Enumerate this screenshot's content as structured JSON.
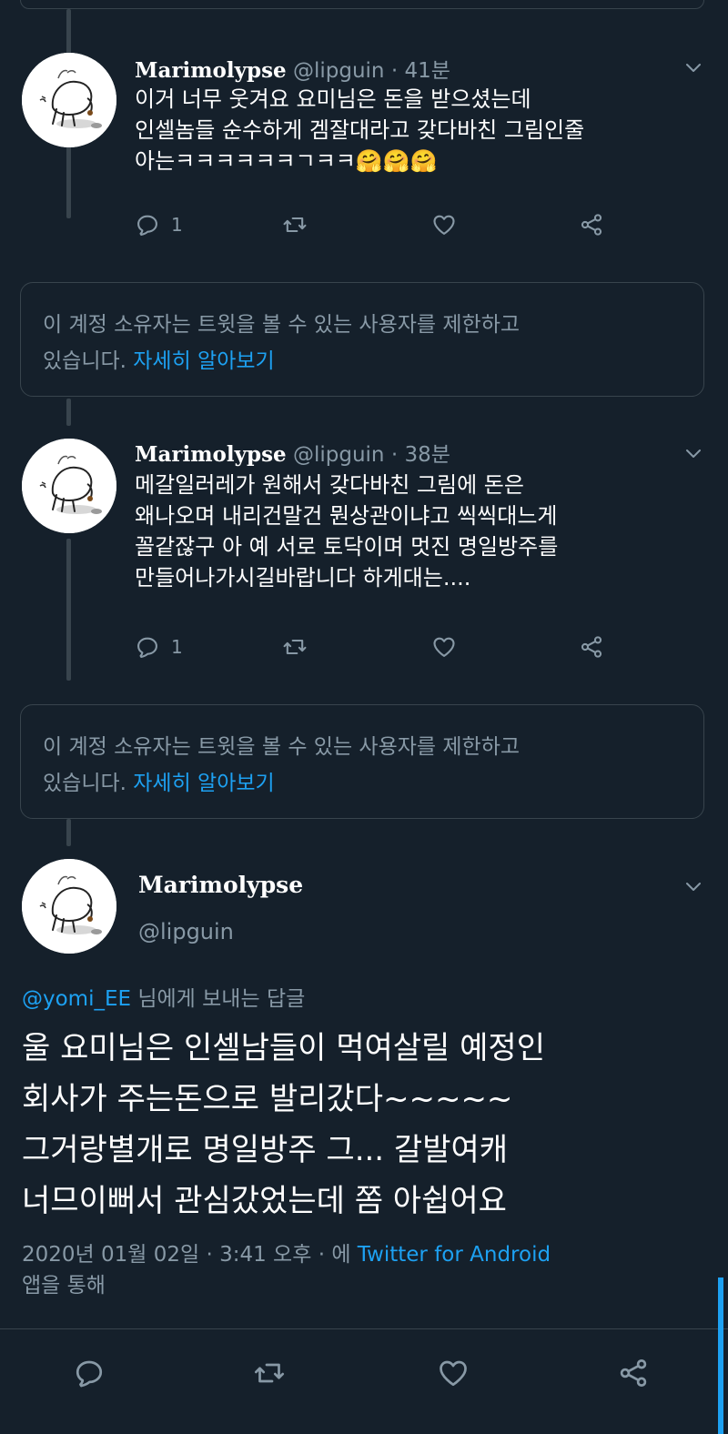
{
  "tweets": [
    {
      "name": "Marimolypse",
      "handle": "@lipguin",
      "time": "41분",
      "lines": [
        "이거 너무 웃겨요 요미님은 돈을 받으셨는데",
        "인셀놈들 순수하게 겜잘대라고 갖다바친 그림인줄",
        "아는ㅋㅋㅋㅋㅋㅋㄱㅋㅋ🤗🤗🤗"
      ],
      "reply_count": "1"
    },
    {
      "name": "Marimolypse",
      "handle": "@lipguin",
      "time": "38분",
      "lines": [
        "메갈일러레가 원해서 갖다바친 그림에 돈은",
        "왜나오며 내리건말건 뭔상관이냐고 씩씩대느게",
        "꼴같잖구 아 예 서로 토닥이며 멋진 명일방주를",
        "만들어나가시길바랍니다 하게대는...."
      ],
      "reply_count": "1"
    }
  ],
  "notice": {
    "line1": "이 계정 소유자는 트윗을 볼 수 있는 사용자를 제한하고",
    "line2_prefix": "있습니다.",
    "link": "자세히 알아보기"
  },
  "main_tweet": {
    "name": "Marimolypse",
    "handle": "@lipguin",
    "replying_mention": "@yomi_EE",
    "replying_suffix": "님에게 보내는 답글",
    "lines": [
      "울 요미님은 인셀남들이 먹여살릴 예정인",
      "회사가 주는돈으로 발리갔다~~~~~",
      "그거랑별개로 명일방주 그... 갈발여캐",
      "너므이뻐서 관심갔었는데 쫌 아쉽어요"
    ],
    "timestamp": "2020년 01월 02일 · 3:41 오후 · 에",
    "app": "Twitter for Android",
    "via": "앱을 통해"
  },
  "separator": "·",
  "icons": {
    "reply": "reply-icon",
    "retweet": "retweet-icon",
    "like": "heart-icon",
    "share": "share-icon",
    "more": "chevron-down-icon"
  },
  "colors": {
    "background": "#15202b",
    "border": "#38444d",
    "secondary_text": "#8899a6",
    "link": "#1da1f2"
  }
}
